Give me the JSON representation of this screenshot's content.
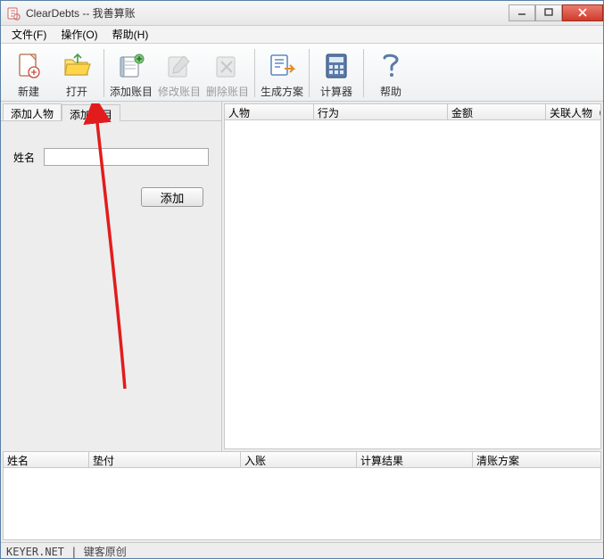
{
  "window": {
    "title": "ClearDebts -- 我善算账"
  },
  "menu": {
    "file": "文件(F)",
    "operate": "操作(O)",
    "help": "帮助(H)"
  },
  "toolbar": {
    "new": "新建",
    "open": "打开",
    "add_entry": "添加账目",
    "edit_entry": "修改账目",
    "delete_entry": "删除账目",
    "generate_plan": "生成方案",
    "calculator": "计算器",
    "help": "帮助"
  },
  "left_tabs": {
    "tab_person": "添加人物",
    "tab_entry": "添加账目"
  },
  "form": {
    "name_label": "姓名",
    "name_value": "",
    "add_button": "添加"
  },
  "right_columns": {
    "person": "人物",
    "action": "行为",
    "amount": "金额",
    "related": "关联人物（分"
  },
  "lower_columns": {
    "name": "姓名",
    "paid": "垫付",
    "income": "入账",
    "result": "计算结果",
    "plan": "清账方案"
  },
  "status": {
    "text": "KEYER.NET | 键客原创"
  }
}
